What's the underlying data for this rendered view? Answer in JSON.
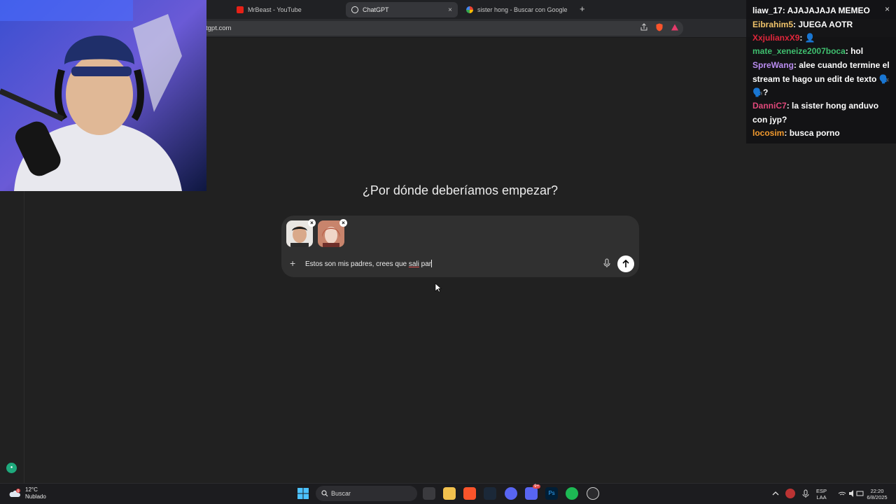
{
  "browser": {
    "tabs": [
      {
        "label": "MrBeast - YouTube",
        "active": false
      },
      {
        "label": "ChatGPT",
        "active": true
      },
      {
        "label": "sister hong - Buscar con Google",
        "active": false
      }
    ],
    "new_tab": "+",
    "url": "tgpt.com",
    "close_tab": "×"
  },
  "chatgpt": {
    "heading": "¿Por dónde deberíamos empezar?",
    "attachments": [
      {
        "remove": "×"
      },
      {
        "remove": "×"
      }
    ],
    "prompt_text_prefix": "Estos son mis padres, crees que ",
    "prompt_text_underlined": "sali",
    "prompt_text_suffix": " par",
    "plus": "+"
  },
  "stream_chat": {
    "close": "×",
    "messages": [
      {
        "user": "liaw_17",
        "color": "#ffffff",
        "text": "AJAJAJAJA MEMEO"
      },
      {
        "user": "Eibrahim5",
        "color": "#f0c36a",
        "text": "JUEGA AOTR"
      },
      {
        "user": "XxjulianxX9",
        "color": "#e0263b",
        "text": "👤"
      },
      {
        "user": "mate_xeneize2007boca",
        "color": "#3fbf6f",
        "text": "hol"
      },
      {
        "user": "SpreWang",
        "color": "#b98cf0",
        "text": "alee cuando termine el stream te hago un edit de texto 🗣️🗣️?"
      },
      {
        "user": "DanniC7",
        "color": "#e0487a",
        "text": "la sister hong anduvo con jyp?"
      },
      {
        "user": "locosim",
        "color": "#f29a2e",
        "text": "busca porno"
      }
    ]
  },
  "taskbar": {
    "weather_temp": "12°C",
    "weather_desc": "Nublado",
    "weather_badge": "6",
    "search_label": "Buscar",
    "lang_top": "ESP",
    "lang_bottom": "LAA",
    "time": "22:20",
    "date": "6/8/2025",
    "discord_badge": "9+"
  },
  "colors": {
    "background": "#212121",
    "composer": "#303030",
    "accent_send": "#ffffff"
  }
}
